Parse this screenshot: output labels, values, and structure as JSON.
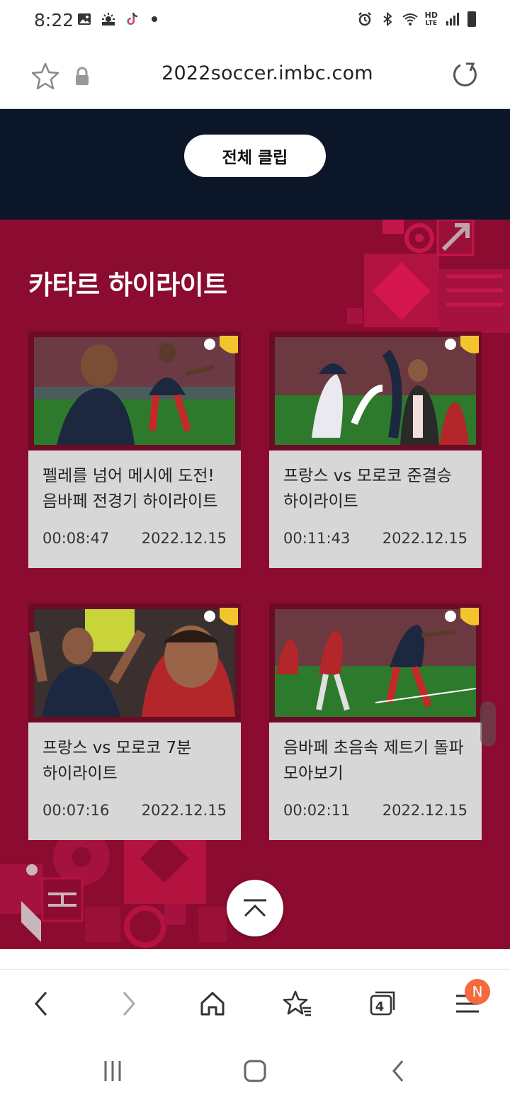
{
  "status_bar": {
    "time": "8:22",
    "left_icons": [
      "image-icon",
      "weather-icon",
      "tiktok-icon",
      "dot-icon"
    ],
    "right_icons": [
      "alarm-icon",
      "bluetooth-icon",
      "wifi-icon",
      "hd-voice-lte-icon",
      "signal-icon",
      "battery-icon"
    ],
    "hd_label": "HD",
    "lte_label": "LTE"
  },
  "url_bar": {
    "url": "2022soccer.imbc.com"
  },
  "banner": {
    "all_clips_label": "전체 클립"
  },
  "section": {
    "title": "카타르 하이라이트"
  },
  "cards": [
    {
      "title": "펠레를 넘어 메시에 도전! 음바페 전경기 하이라이트",
      "duration": "00:08:47",
      "date": "2022.12.15"
    },
    {
      "title": "프랑스 vs 모로코 준결승 하이라이트",
      "duration": "00:11:43",
      "date": "2022.12.15"
    },
    {
      "title": "프랑스 vs 모로코 7분 하이라이트",
      "duration": "00:07:16",
      "date": "2022.12.15"
    },
    {
      "title": "음바페 초음속 제트기 돌파 모아보기",
      "duration": "00:02:11",
      "date": "2022.12.15"
    }
  ],
  "toolbar": {
    "tab_count": "4",
    "notification_badge": "N"
  },
  "colors": {
    "navy": "#0b1628",
    "crimson": "#8c0b30",
    "card_bg": "#d7d7d7",
    "badge": "#f26a3d"
  }
}
